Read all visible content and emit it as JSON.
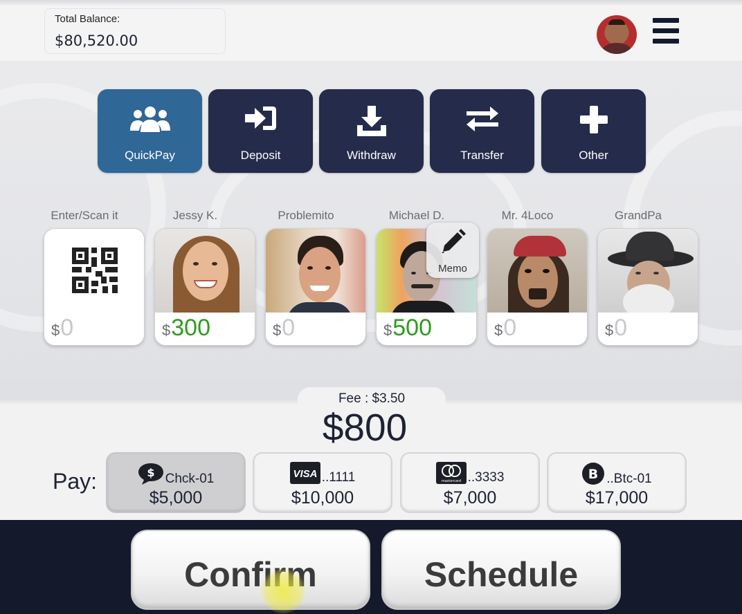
{
  "header": {
    "balance_label": "Total Balance:",
    "balance_value": "$80,520.00",
    "avatar_icon": "user-avatar",
    "menu_icon": "hamburger-menu-icon"
  },
  "actions": [
    {
      "label": "QuickPay",
      "icon": "group-icon",
      "active": true
    },
    {
      "label": "Deposit",
      "icon": "sign-in-icon",
      "active": false
    },
    {
      "label": "Withdraw",
      "icon": "download-icon",
      "active": false
    },
    {
      "label": "Transfer",
      "icon": "exchange-icon",
      "active": false
    },
    {
      "label": "Other",
      "icon": "plus-icon",
      "active": false
    }
  ],
  "recipients": [
    {
      "name": "Enter/Scan it",
      "currency": "$",
      "amount": "0"
    },
    {
      "name": "Jessy K.",
      "currency": "$",
      "amount": "300"
    },
    {
      "name": "Problemito",
      "currency": "$",
      "amount": "0"
    },
    {
      "name": "Michael D.",
      "currency": "$",
      "amount": "500"
    },
    {
      "name": "Mr. 4Loco",
      "currency": "$",
      "amount": "0"
    },
    {
      "name": "GrandPa",
      "currency": "$",
      "amount": "0"
    }
  ],
  "memo": {
    "label": "Memo",
    "icon": "pencil-icon"
  },
  "summary": {
    "fee": "Fee : $3.50",
    "total": "$800"
  },
  "pay": {
    "label": "Pay:",
    "methods": [
      {
        "icon": "check-icon",
        "name": "Chck-01",
        "amount": "$5,000",
        "selected": true
      },
      {
        "icon": "visa-icon",
        "icon_text": "VISA",
        "name": "..1111",
        "amount": "$10,000",
        "selected": false
      },
      {
        "icon": "mastercard-icon",
        "icon_text": "mastercard",
        "name": "..3333",
        "amount": "$7,000",
        "selected": false
      },
      {
        "icon": "bitcoin-icon",
        "name": "..Btc-01",
        "amount": "$17,000",
        "selected": false
      }
    ]
  },
  "buttons": {
    "confirm": "Confirm",
    "schedule": "Schedule"
  },
  "colors": {
    "active_tile": "#2f6796",
    "tile": "#252b4a",
    "positive": "#2f9a1f",
    "bottom_bar": "#141a2c"
  }
}
